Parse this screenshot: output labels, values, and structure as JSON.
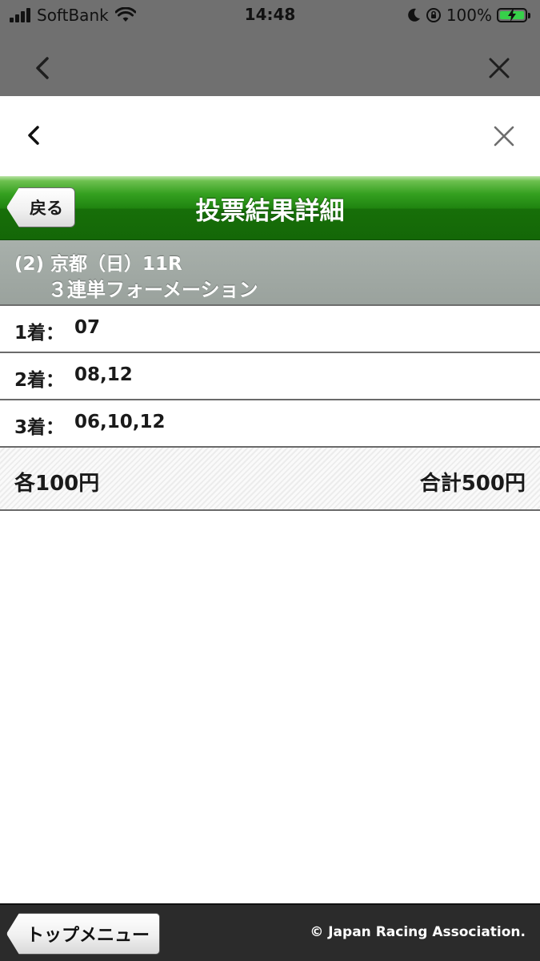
{
  "status_bar": {
    "carrier": "SoftBank",
    "time": "14:48",
    "battery": "100%",
    "battery_level": 1.0
  },
  "browser": {
    "back_icon": "chevron-left-icon",
    "close_icon": "close-icon"
  },
  "header": {
    "back_label": "戻る",
    "title": "投票結果詳細"
  },
  "race": {
    "line1": "(2) 京都（日）11R",
    "line2": "３連単フォーメーション"
  },
  "selections": [
    {
      "position": "1着：",
      "numbers": "07"
    },
    {
      "position": "2着：",
      "numbers": "08,12"
    },
    {
      "position": "3着：",
      "numbers": "06,10,12"
    }
  ],
  "amount": {
    "each": "各100円",
    "total": "合計500円"
  },
  "footer": {
    "top_menu_label": "トップメニュー",
    "copyright": "© Japan Racing Association."
  },
  "colors": {
    "title_bar_green": "#1f8410",
    "race_header_gray": "#9aa29d",
    "footer_dark": "#2b2b2b"
  }
}
